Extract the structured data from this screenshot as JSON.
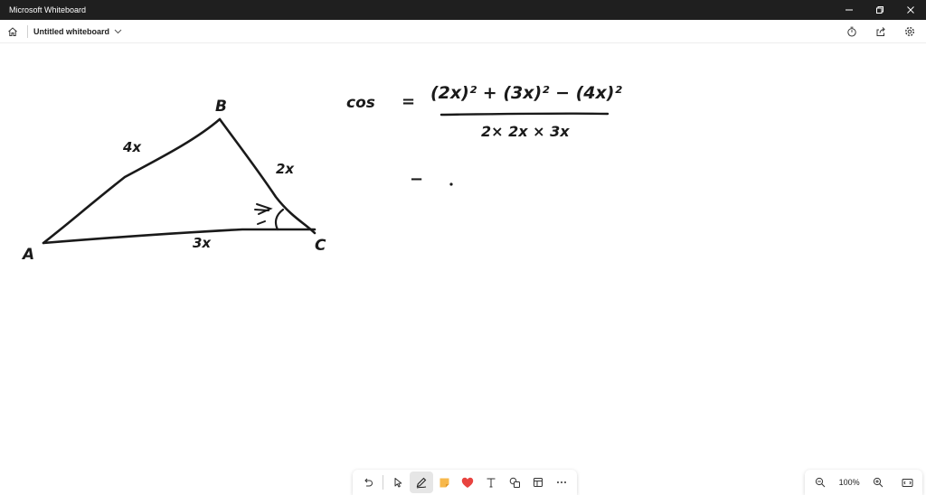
{
  "titlebar": {
    "app_title": "Microsoft Whiteboard"
  },
  "appbar": {
    "board_name": "Untitled whiteboard"
  },
  "drawing": {
    "vertex_a": "A",
    "vertex_b": "B",
    "vertex_c": "C",
    "side_ab": "4x",
    "side_bc": "2x",
    "side_ac": "3x",
    "cos_label": "cos",
    "equals": "=",
    "numerator": "(2x)² + (3x)² − (4x)²",
    "denominator": "2× 2x × 3x",
    "equals_2": "−"
  },
  "ink_colors": {
    "black": "#1a1a1a",
    "red": "#d1344a",
    "blue": "#3fa6d9",
    "yellow": "#f4f23a",
    "pink": "#f2a0b0",
    "eraser": "#d8d8d8"
  },
  "icons": {
    "home": "home-icon",
    "chevron": "chevron-down-icon",
    "timer": "timer-icon",
    "share": "share-icon",
    "settings": "gear-icon",
    "undo": "undo-icon",
    "select": "pointer-icon",
    "pen": "pen-icon",
    "sticky": "sticky-note-icon",
    "reaction": "heart-icon",
    "text": "text-icon",
    "shapes": "shapes-icon",
    "templates": "templates-icon",
    "more": "more-icon",
    "zoom_out": "zoom-out-icon",
    "zoom_in": "zoom-in-icon",
    "fit": "fit-screen-icon"
  },
  "zoom": {
    "level": "100%"
  }
}
